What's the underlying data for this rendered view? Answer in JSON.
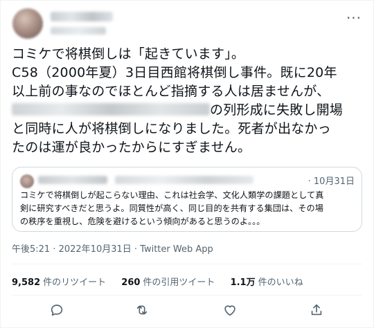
{
  "tweet": {
    "lines": [
      "コミケで将棋倒しは「起きています」。",
      "C58（2000年夏）3日目西館将棋倒し事件。既に20年",
      "以上前の事なのでほとんど指摘する人は居ませんが、",
      "の列形成に失敗し開場",
      "と同時に人が将棋倒しになりました。死者が出なかっ",
      "たのは運が良かったからにすぎません。"
    ]
  },
  "quote": {
    "date": "· 10月31日",
    "lines": [
      "コミケで将棋倒しが起こらない理由、これは社会学、文化人類学の課題として真",
      "剣に研究すべきだと思うよ。同質性が高く、同じ目的を共有する集団は、その場",
      "の秩序を重視し、危険を避けるという傾向があると思うのよ。。。"
    ]
  },
  "meta": {
    "timestamp": "午後5:21 · 2022年10月31日 · Twitter Web App"
  },
  "stats": {
    "retweets": {
      "count": "9,582",
      "label": "件のリツイート"
    },
    "quotes": {
      "count": "260",
      "label": "件の引用ツイート"
    },
    "likes": {
      "count": "1.1万",
      "label": "件のいいね"
    }
  },
  "icons": {
    "more": "more-icon",
    "reply": "reply-icon",
    "retweet": "retweet-icon",
    "like": "like-icon",
    "share": "share-icon"
  },
  "colors": {
    "text": "#0f1419",
    "muted": "#536471",
    "border": "#cfd9de"
  }
}
